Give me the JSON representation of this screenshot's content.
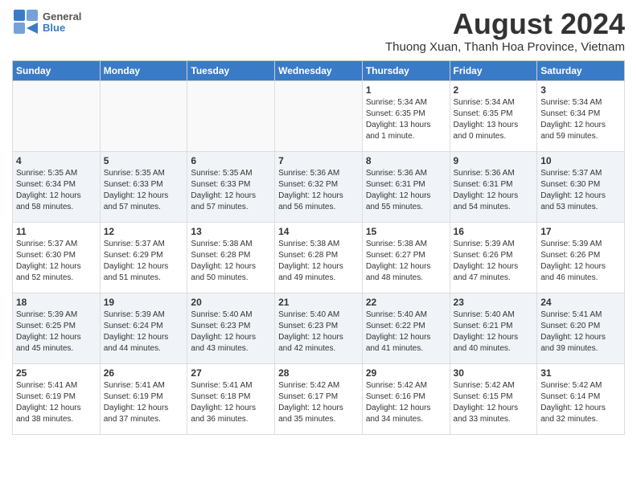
{
  "header": {
    "logo_general": "General",
    "logo_blue": "Blue",
    "title": "August 2024",
    "subtitle": "Thuong Xuan, Thanh Hoa Province, Vietnam"
  },
  "weekdays": [
    "Sunday",
    "Monday",
    "Tuesday",
    "Wednesday",
    "Thursday",
    "Friday",
    "Saturday"
  ],
  "weeks": [
    [
      {
        "day": "",
        "info": ""
      },
      {
        "day": "",
        "info": ""
      },
      {
        "day": "",
        "info": ""
      },
      {
        "day": "",
        "info": ""
      },
      {
        "day": "1",
        "info": "Sunrise: 5:34 AM\nSunset: 6:35 PM\nDaylight: 13 hours\nand 1 minute."
      },
      {
        "day": "2",
        "info": "Sunrise: 5:34 AM\nSunset: 6:35 PM\nDaylight: 13 hours\nand 0 minutes."
      },
      {
        "day": "3",
        "info": "Sunrise: 5:34 AM\nSunset: 6:34 PM\nDaylight: 12 hours\nand 59 minutes."
      }
    ],
    [
      {
        "day": "4",
        "info": "Sunrise: 5:35 AM\nSunset: 6:34 PM\nDaylight: 12 hours\nand 58 minutes."
      },
      {
        "day": "5",
        "info": "Sunrise: 5:35 AM\nSunset: 6:33 PM\nDaylight: 12 hours\nand 57 minutes."
      },
      {
        "day": "6",
        "info": "Sunrise: 5:35 AM\nSunset: 6:33 PM\nDaylight: 12 hours\nand 57 minutes."
      },
      {
        "day": "7",
        "info": "Sunrise: 5:36 AM\nSunset: 6:32 PM\nDaylight: 12 hours\nand 56 minutes."
      },
      {
        "day": "8",
        "info": "Sunrise: 5:36 AM\nSunset: 6:31 PM\nDaylight: 12 hours\nand 55 minutes."
      },
      {
        "day": "9",
        "info": "Sunrise: 5:36 AM\nSunset: 6:31 PM\nDaylight: 12 hours\nand 54 minutes."
      },
      {
        "day": "10",
        "info": "Sunrise: 5:37 AM\nSunset: 6:30 PM\nDaylight: 12 hours\nand 53 minutes."
      }
    ],
    [
      {
        "day": "11",
        "info": "Sunrise: 5:37 AM\nSunset: 6:30 PM\nDaylight: 12 hours\nand 52 minutes."
      },
      {
        "day": "12",
        "info": "Sunrise: 5:37 AM\nSunset: 6:29 PM\nDaylight: 12 hours\nand 51 minutes."
      },
      {
        "day": "13",
        "info": "Sunrise: 5:38 AM\nSunset: 6:28 PM\nDaylight: 12 hours\nand 50 minutes."
      },
      {
        "day": "14",
        "info": "Sunrise: 5:38 AM\nSunset: 6:28 PM\nDaylight: 12 hours\nand 49 minutes."
      },
      {
        "day": "15",
        "info": "Sunrise: 5:38 AM\nSunset: 6:27 PM\nDaylight: 12 hours\nand 48 minutes."
      },
      {
        "day": "16",
        "info": "Sunrise: 5:39 AM\nSunset: 6:26 PM\nDaylight: 12 hours\nand 47 minutes."
      },
      {
        "day": "17",
        "info": "Sunrise: 5:39 AM\nSunset: 6:26 PM\nDaylight: 12 hours\nand 46 minutes."
      }
    ],
    [
      {
        "day": "18",
        "info": "Sunrise: 5:39 AM\nSunset: 6:25 PM\nDaylight: 12 hours\nand 45 minutes."
      },
      {
        "day": "19",
        "info": "Sunrise: 5:39 AM\nSunset: 6:24 PM\nDaylight: 12 hours\nand 44 minutes."
      },
      {
        "day": "20",
        "info": "Sunrise: 5:40 AM\nSunset: 6:23 PM\nDaylight: 12 hours\nand 43 minutes."
      },
      {
        "day": "21",
        "info": "Sunrise: 5:40 AM\nSunset: 6:23 PM\nDaylight: 12 hours\nand 42 minutes."
      },
      {
        "day": "22",
        "info": "Sunrise: 5:40 AM\nSunset: 6:22 PM\nDaylight: 12 hours\nand 41 minutes."
      },
      {
        "day": "23",
        "info": "Sunrise: 5:40 AM\nSunset: 6:21 PM\nDaylight: 12 hours\nand 40 minutes."
      },
      {
        "day": "24",
        "info": "Sunrise: 5:41 AM\nSunset: 6:20 PM\nDaylight: 12 hours\nand 39 minutes."
      }
    ],
    [
      {
        "day": "25",
        "info": "Sunrise: 5:41 AM\nSunset: 6:19 PM\nDaylight: 12 hours\nand 38 minutes."
      },
      {
        "day": "26",
        "info": "Sunrise: 5:41 AM\nSunset: 6:19 PM\nDaylight: 12 hours\nand 37 minutes."
      },
      {
        "day": "27",
        "info": "Sunrise: 5:41 AM\nSunset: 6:18 PM\nDaylight: 12 hours\nand 36 minutes."
      },
      {
        "day": "28",
        "info": "Sunrise: 5:42 AM\nSunset: 6:17 PM\nDaylight: 12 hours\nand 35 minutes."
      },
      {
        "day": "29",
        "info": "Sunrise: 5:42 AM\nSunset: 6:16 PM\nDaylight: 12 hours\nand 34 minutes."
      },
      {
        "day": "30",
        "info": "Sunrise: 5:42 AM\nSunset: 6:15 PM\nDaylight: 12 hours\nand 33 minutes."
      },
      {
        "day": "31",
        "info": "Sunrise: 5:42 AM\nSunset: 6:14 PM\nDaylight: 12 hours\nand 32 minutes."
      }
    ]
  ]
}
